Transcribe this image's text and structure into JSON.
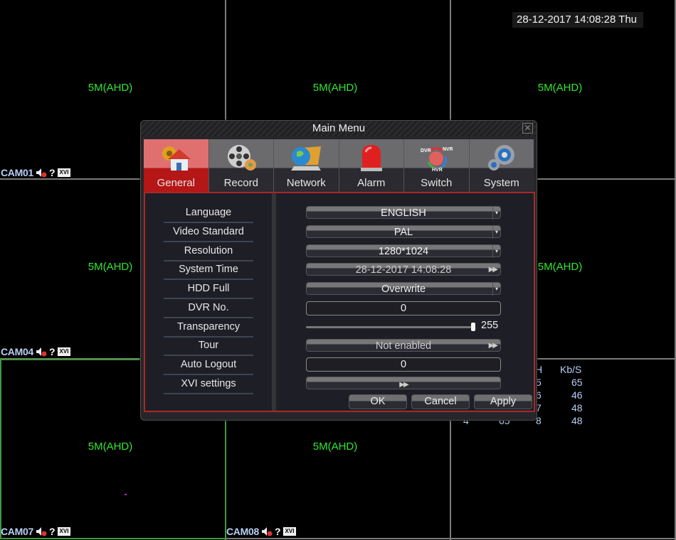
{
  "datetime": "28-12-2017 14:08:28 Thu",
  "cells": [
    {
      "camera": "CAM01",
      "resolution": "5M(AHD)"
    },
    {
      "camera": "",
      "resolution": "5M(AHD)"
    },
    {
      "camera": "",
      "resolution": "5M(AHD)"
    },
    {
      "camera": "CAM04",
      "resolution": "5M(AHD)"
    },
    {
      "camera": "",
      "resolution": ""
    },
    {
      "camera": "",
      "resolution": "5M(AHD)"
    },
    {
      "camera": "CAM07",
      "resolution": "5M(AHD)"
    },
    {
      "camera": "CAM08",
      "resolution": "5M(AHD)"
    },
    {
      "camera": "",
      "resolution": ""
    }
  ],
  "cam_badge": {
    "audio_icon": "audio-muted-icon",
    "unknown": "?",
    "xvi": "XVI"
  },
  "selected_cell": "CAM07",
  "bitrate": {
    "headers": [
      "H",
      "Kb/S"
    ],
    "rows": [
      {
        "ch": "5",
        "kbs": "65"
      },
      {
        "ch": "6",
        "kbs": "46"
      },
      {
        "ch": "7",
        "kbs": "48"
      },
      {
        "ch": "8",
        "kbs": "48"
      }
    ],
    "partial_row": {
      "ch": "4",
      "kbs": "65"
    }
  },
  "menu": {
    "title": "Main Menu",
    "tabs": [
      {
        "label": "General",
        "icon": "house-gear-icon",
        "active": true
      },
      {
        "label": "Record",
        "icon": "film-reel-icon",
        "active": false
      },
      {
        "label": "Network",
        "icon": "globe-laptop-icon",
        "active": false
      },
      {
        "label": "Alarm",
        "icon": "siren-icon",
        "active": false
      },
      {
        "label": "Switch",
        "icon": "dvr-nvr-hvr-switch-icon",
        "active": false
      },
      {
        "label": "System",
        "icon": "gears-icon",
        "active": false
      }
    ],
    "fields": {
      "language": {
        "label": "Language",
        "value": "ENGLISH"
      },
      "video_standard": {
        "label": "Video Standard",
        "value": "PAL"
      },
      "resolution": {
        "label": "Resolution",
        "value": "1280*1024"
      },
      "system_time": {
        "label": "System Time",
        "value": "28-12-2017 14:08:28"
      },
      "hdd_full": {
        "label": "HDD Full",
        "value": "Overwrite"
      },
      "dvr_no": {
        "label": "DVR No.",
        "value": "0"
      },
      "transparency": {
        "label": "Transparency",
        "value": "255",
        "fraction": 1.0
      },
      "tour": {
        "label": "Tour",
        "value": "Not enabled"
      },
      "auto_logout": {
        "label": "Auto Logout",
        "value": "0"
      },
      "xvi_settings": {
        "label": "XVI settings",
        "value": ""
      }
    },
    "buttons": {
      "ok": "OK",
      "cancel": "Cancel",
      "apply": "Apply"
    },
    "arrow_down": "▾",
    "arrow_forward": "▶▶"
  },
  "colors": {
    "resolution_text": "#2ee82e",
    "camera_label": "#b8cff5",
    "active_tab": "#b51616",
    "selected_border": "#3d9a3d"
  }
}
